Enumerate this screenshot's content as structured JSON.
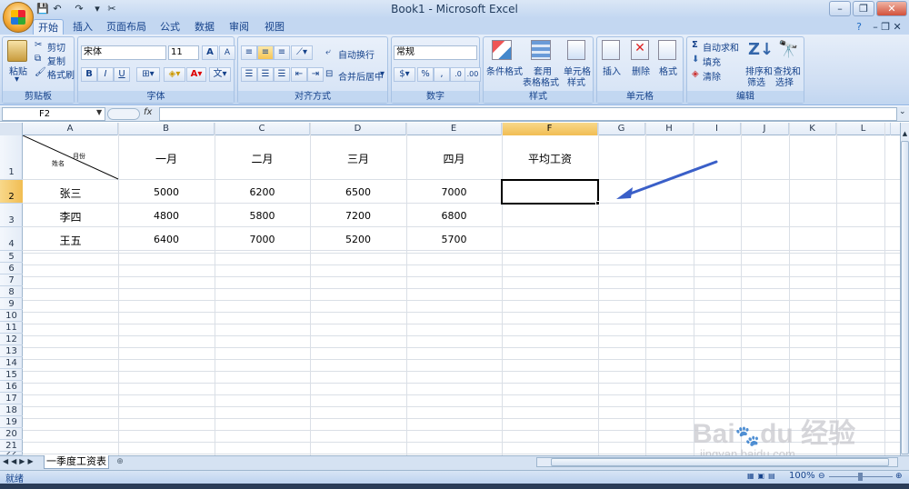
{
  "window": {
    "title": "Book1 - Microsoft Excel",
    "help": "?",
    "min": "–",
    "max": "❐",
    "close": "✕"
  },
  "tabs": [
    "开始",
    "插入",
    "页面布局",
    "公式",
    "数据",
    "审阅",
    "视图"
  ],
  "ribbon": {
    "clipboard": {
      "paste": "粘贴",
      "cut": "剪切",
      "copy": "复制",
      "format_painter": "格式刷",
      "label": "剪贴板"
    },
    "font": {
      "name": "宋体",
      "size": "11",
      "grow": "A",
      "shrink": "A",
      "bold": "B",
      "italic": "I",
      "underline": "U",
      "label": "字体"
    },
    "alignment": {
      "wrap": "自动换行",
      "merge": "合并后居中",
      "label": "对齐方式"
    },
    "number": {
      "format": "常规",
      "percent": "%",
      "comma": ",",
      "label": "数字"
    },
    "styles": {
      "conditional": "条件格式",
      "table_line1": "套用",
      "table_line2": "表格格式",
      "cell_line1": "单元格",
      "cell_line2": "样式",
      "label": "样式"
    },
    "cells": {
      "insert": "插入",
      "delete": "删除",
      "format": "格式",
      "label": "单元格"
    },
    "editing": {
      "autosum": "自动求和",
      "fill": "填充",
      "clear": "清除",
      "sort_line1": "排序和",
      "sort_line2": "筛选",
      "find_line1": "查找和",
      "find_line2": "选择",
      "label": "编辑"
    }
  },
  "formula_bar": {
    "name_box": "F2",
    "fx": "fx",
    "value": ""
  },
  "columns": [
    "A",
    "B",
    "C",
    "D",
    "E",
    "F",
    "G",
    "H",
    "I",
    "J",
    "K",
    "L"
  ],
  "rows": [
    "1",
    "2",
    "3",
    "4",
    "5",
    "6",
    "7",
    "8",
    "9",
    "10",
    "11",
    "12",
    "13",
    "14",
    "15",
    "16",
    "17",
    "18",
    "19",
    "20",
    "21",
    "22"
  ],
  "header_row": {
    "corner_top": "月份",
    "corner_bottom": "姓名",
    "jan": "一月",
    "feb": "二月",
    "mar": "三月",
    "apr": "四月",
    "avg": "平均工资"
  },
  "table": [
    {
      "name": "张三",
      "values": [
        "5000",
        "6200",
        "6500",
        "7000"
      ],
      "avg": ""
    },
    {
      "name": "李四",
      "values": [
        "4800",
        "5800",
        "7200",
        "6800"
      ],
      "avg": ""
    },
    {
      "name": "王五",
      "values": [
        "6400",
        "7000",
        "5200",
        "5700"
      ],
      "avg": ""
    }
  ],
  "sheet_tab": "一季度工资表",
  "status": {
    "ready": "就绪",
    "zoom": "100%"
  },
  "watermark": {
    "logo": "Bai du 经验",
    "url": "jingyan.baidu.com"
  }
}
